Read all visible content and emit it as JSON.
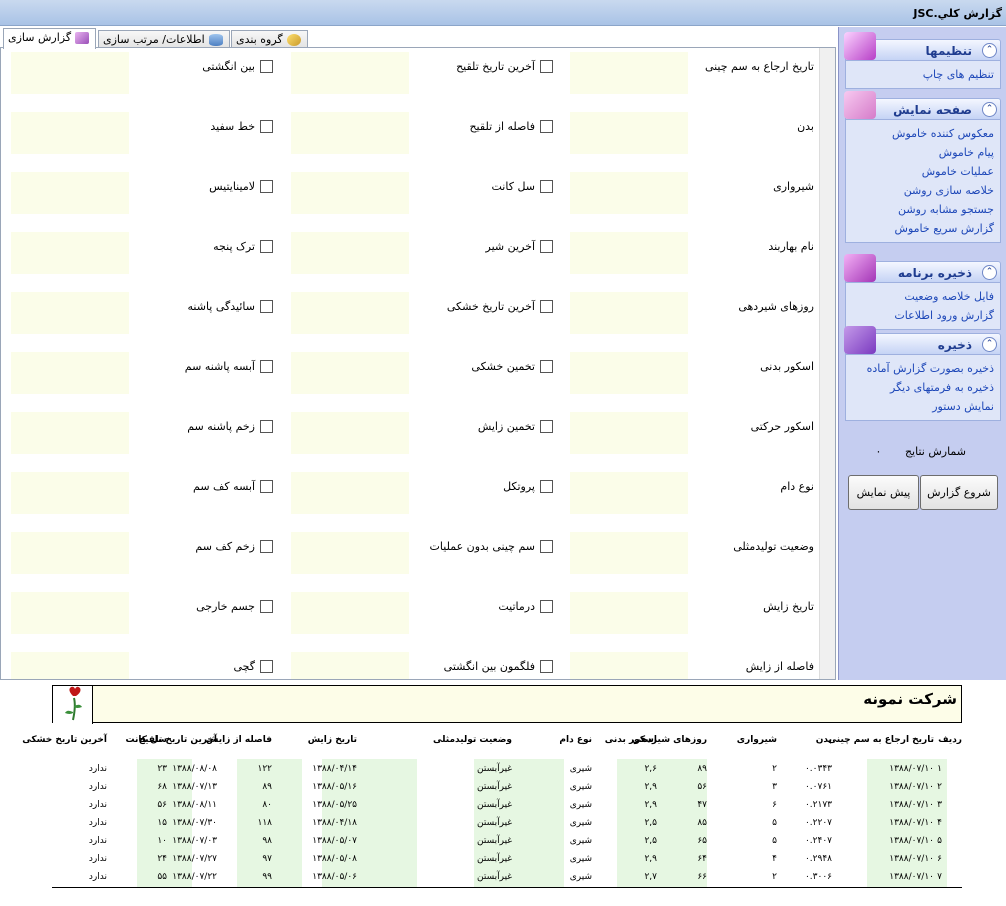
{
  "window": {
    "title": "گزارش کلي.JSC"
  },
  "tabs": [
    {
      "label": "گزارش سازی",
      "active": true
    },
    {
      "label": "اطلاعات/ مرتب سازی",
      "active": false
    },
    {
      "label": "گروه بندی",
      "active": false
    }
  ],
  "fields_col1": [
    "تاریخ ارجاع به سم چینی",
    "بدن",
    "شیرواری",
    "نام بهاربند",
    "روزهای شیردهی",
    "اسکور بدنی",
    "اسکور حرکتی",
    "نوع دام",
    "وضعیت تولیدمثلی",
    "تاریخ زایش",
    "فاصله از زایش"
  ],
  "fields_col2": [
    "آخرین تاریخ تلقیح",
    "فاصله از تلقیح",
    "سل کانت",
    "آخرین شیر",
    "آخرین تاریخ خشکی",
    "تخمین خشکی",
    "تخمین زایش",
    "پروتکل",
    "سم چینی بدون عملیات",
    "درماتیت",
    "فلگمون بین انگشتی"
  ],
  "fields_col3": [
    "بین انگشتی",
    "خط سفید",
    "لامینایتیس",
    "ترک پنجه",
    "سائیدگی پاشنه",
    "آبسه پاشنه سم",
    "زخم پاشنه سم",
    "آبسه کف سم",
    "زخم کف سم",
    "جسم خارجی",
    "گچی"
  ],
  "panel": {
    "groups": [
      {
        "title": "تنظیمها",
        "items": [
          "تنظیم های چاپ"
        ]
      },
      {
        "title": "صفحه نمایش",
        "items": [
          "معکوس کننده خاموش",
          "پیام خاموش",
          "عملیات خاموش",
          "خلاصه سازی روشن",
          "جستجو مشابه روشن",
          "گزارش سریع خاموش"
        ]
      },
      {
        "title": "ذخیره برنامه",
        "items": [
          "فایل خلاصه وضعیت",
          "گزارش ورود اطلاعات"
        ]
      },
      {
        "title": "ذخیره",
        "items": [
          "ذخیره بصورت گزارش آماده",
          "ذخیره به فرمتهای دیگر",
          "نمایش دستور"
        ]
      }
    ],
    "count_label": "شمارش نتایج",
    "count_value": "۰",
    "start_button": "شروع گزارش",
    "preview_button": "پیش نمایش"
  },
  "report": {
    "company": "شرکت نمونه",
    "headers": [
      "ردیف",
      "تاریخ ارجاع به سم چینی",
      "بدن",
      "شیرواری",
      "روزهای شیردهی",
      "اسکور بدنی",
      "نوع دام",
      "وضعیت تولیدمثلی",
      "تاریخ زایش",
      "فاصله از زایش",
      "آخرین تاریخ تلقیح",
      "سل کانت",
      "آخرین تاریخ خشکی"
    ],
    "rows": [
      [
        "۱",
        "۱۳۸۸/۰۷/۱۰",
        "۰.۰۳۴۳",
        "۲",
        "۸۹",
        "۲,۶",
        "شیری",
        "غیرآبستن",
        "۱۳۸۸/۰۴/۱۴",
        "۱۲۲",
        "۱۳۸۸/۰۸/۰۸",
        "۲۳",
        "ندارد"
      ],
      [
        "۲",
        "۱۳۸۸/۰۷/۱۰",
        "۰.۰۷۶۱",
        "۳",
        "۵۶",
        "۲,۹",
        "شیری",
        "غیرآبستن",
        "۱۳۸۸/۰۵/۱۶",
        "۸۹",
        "۱۳۸۸/۰۷/۱۳",
        "۶۸",
        "ندارد"
      ],
      [
        "۳",
        "۱۳۸۸/۰۷/۱۰",
        "۰.۲۱۷۳",
        "۶",
        "۴۷",
        "۲,۹",
        "شیری",
        "غیرآبستن",
        "۱۳۸۸/۰۵/۲۵",
        "۸۰",
        "۱۳۸۸/۰۸/۱۱",
        "۵۶",
        "ندارد"
      ],
      [
        "۴",
        "۱۳۸۸/۰۷/۱۰",
        "۰.۲۲۰۷",
        "۵",
        "۸۵",
        "۲,۵",
        "شیری",
        "غیرآبستن",
        "۱۳۸۸/۰۴/۱۸",
        "۱۱۸",
        "۱۳۸۸/۰۷/۳۰",
        "۱۵",
        "ندارد"
      ],
      [
        "۵",
        "۱۳۸۸/۰۷/۱۰",
        "۰.۲۴۰۷",
        "۵",
        "۶۵",
        "۲,۵",
        "شیری",
        "غیرآبستن",
        "۱۳۸۸/۰۵/۰۷",
        "۹۸",
        "۱۳۸۸/۰۷/۰۳",
        "۱۰",
        "ندارد"
      ],
      [
        "۶",
        "۱۳۸۸/۰۷/۱۰",
        "۰.۲۹۴۸",
        "۴",
        "۶۴",
        "۲,۹",
        "شیری",
        "غیرآبستن",
        "۱۳۸۸/۰۵/۰۸",
        "۹۷",
        "۱۳۸۸/۰۷/۲۷",
        "۲۴",
        "ندارد"
      ],
      [
        "۷",
        "۱۳۸۸/۰۷/۱۰",
        "۰.۳۰۰۶",
        "۲",
        "۶۶",
        "۲,۷",
        "شیری",
        "غیرآبستن",
        "۱۳۸۸/۰۵/۰۶",
        "۹۹",
        "۱۳۸۸/۰۷/۲۲",
        "۵۵",
        "ندارد"
      ]
    ]
  },
  "colors": {
    "panel_bg": "#c5cdf0",
    "link": "#1d47b8",
    "field_box": "#fbfde9",
    "report_band": "#e6f7e2"
  }
}
